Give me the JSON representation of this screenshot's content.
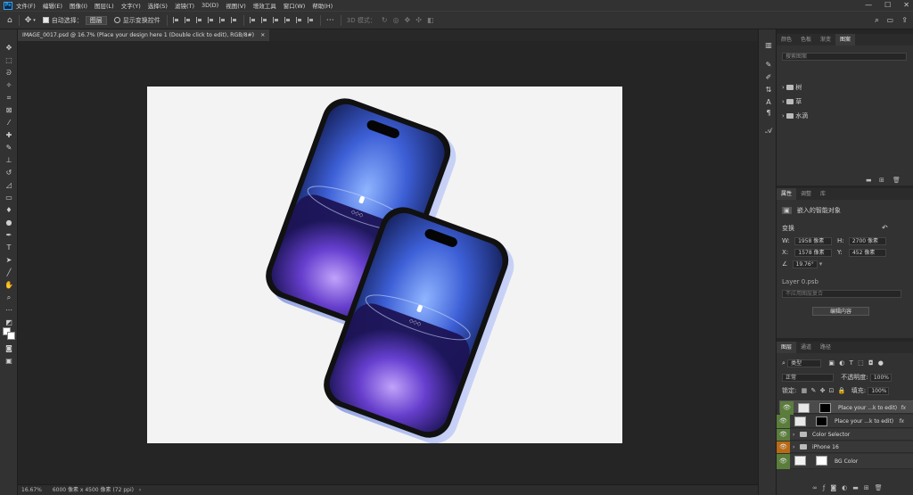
{
  "app": {
    "logo_text": "Ps"
  },
  "menu": [
    "文件(F)",
    "编辑(E)",
    "图像(I)",
    "图层(L)",
    "文字(Y)",
    "选择(S)",
    "滤镜(T)",
    "3D(D)",
    "视图(V)",
    "增效工具",
    "窗口(W)",
    "帮助(H)"
  ],
  "window_controls": {
    "minimize": "—",
    "maximize": "☐",
    "close": "✕"
  },
  "options": {
    "auto_select_label": "自动选择：",
    "auto_select_value": "图层",
    "show_transform_label": "显示变换控件",
    "mode_3d_label": "3D 模式："
  },
  "document": {
    "tab_title": "IMAGE_0017.psd @ 16.7% (Place your design here 1 (Double click to edit), RGB/8#)",
    "tab_close": "×",
    "zoom": "16.67%",
    "size_info": "6000 像素 x 4500 像素 (72 ppi)"
  },
  "swatches_panel": {
    "tabs": [
      "颜色",
      "色板",
      "渐变",
      "图案"
    ],
    "active_tab": 3,
    "search_placeholder": "搜索图案",
    "groups": [
      "树",
      "草",
      "水滴"
    ]
  },
  "properties_panel": {
    "tabs": [
      "属性",
      "调整",
      "库"
    ],
    "active_tab": 0,
    "type_label": "嵌入的智能对象",
    "transform_label": "变换",
    "w_label": "W:",
    "w_value": "1958 像素",
    "h_label": "H:",
    "h_value": "2700 像素",
    "x_label": "X:",
    "x_value": "1578 像素",
    "y_label": "Y:",
    "y_value": "452 像素",
    "angle_value": "19.76°",
    "linked_file": "Layer 0.psb",
    "comp_placeholder": "不应用图层复合",
    "edit_button": "编辑内容"
  },
  "layers_panel": {
    "tabs": [
      "图层",
      "通道",
      "路径"
    ],
    "active_tab": 0,
    "filter_kind": "类型",
    "blend_mode": "正常",
    "opacity_label": "不透明度:",
    "opacity_value": "100%",
    "lock_label": "锁定:",
    "fill_label": "填充:",
    "fill_value": "100%",
    "layers": [
      {
        "name": "Place your ...k to edit)",
        "kind": "smart",
        "selected": true,
        "fx": "fx",
        "eye_color": "green"
      },
      {
        "name": "Place your ...k to edit)",
        "kind": "smart",
        "selected": false,
        "fx": "fx",
        "eye_color": "green"
      },
      {
        "name": "Color Selector",
        "kind": "group",
        "selected": false,
        "fx": "",
        "eye_color": "green"
      },
      {
        "name": "iPhone 16",
        "kind": "group",
        "selected": false,
        "fx": "",
        "eye_color": "orange"
      },
      {
        "name": "BG Color",
        "kind": "fill",
        "selected": false,
        "fx": "",
        "eye_color": "green"
      }
    ]
  }
}
